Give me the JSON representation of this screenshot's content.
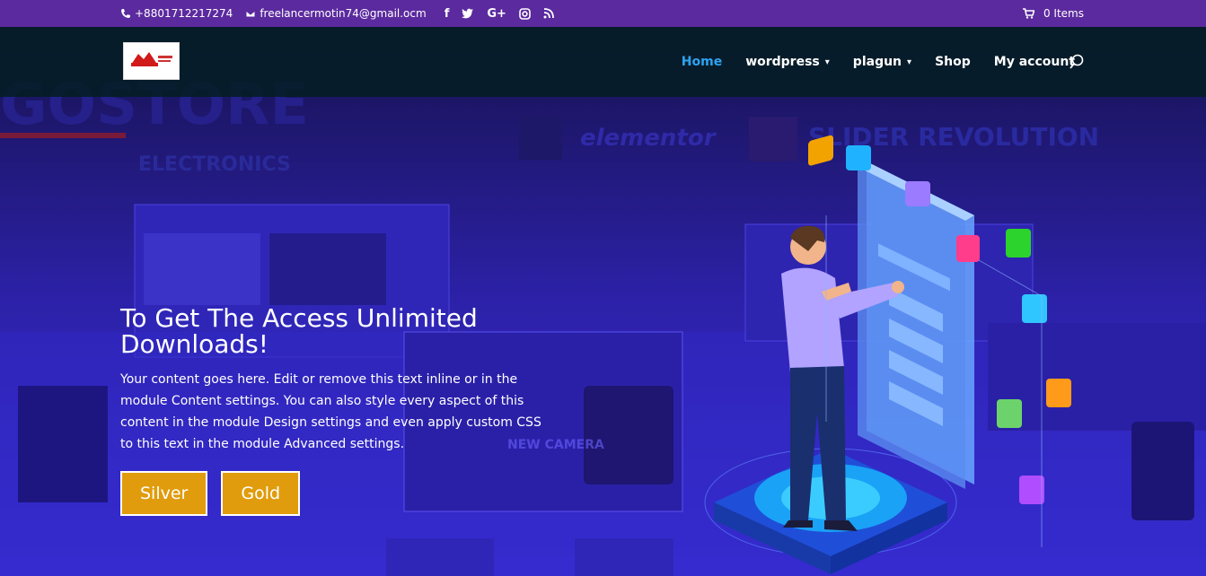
{
  "topbar": {
    "phone": "+8801712217274",
    "email": "freelancermotin74@gmail.ocm",
    "social": [
      "facebook-icon",
      "twitter-icon",
      "google-plus-icon",
      "instagram-icon",
      "rss-icon"
    ],
    "cart_label": "0 Items"
  },
  "nav": {
    "items": [
      {
        "label": "Home",
        "active": true,
        "dropdown": false
      },
      {
        "label": "wordpress",
        "active": false,
        "dropdown": true
      },
      {
        "label": "plagun",
        "active": false,
        "dropdown": true
      },
      {
        "label": "Shop",
        "active": false,
        "dropdown": false
      },
      {
        "label": "My account",
        "active": false,
        "dropdown": false
      }
    ]
  },
  "hero": {
    "bg_words": [
      "GOSTORE",
      "ELECTRONICS",
      "elementor",
      "SLIDER REVOLUTION"
    ],
    "title": "To Get The Access Unlimited Downloads!",
    "body": "Your content goes here. Edit or remove this text inline or in the module Content settings. You can also style every aspect of this content in the module Design settings and even apply custom CSS to this text in the module Advanced settings.",
    "buttons": [
      {
        "label": "Silver"
      },
      {
        "label": "Gold"
      }
    ]
  },
  "colors": {
    "topbar": "#5b2a9e",
    "nav_active": "#2ea3f2",
    "button": "#e09c0c"
  }
}
